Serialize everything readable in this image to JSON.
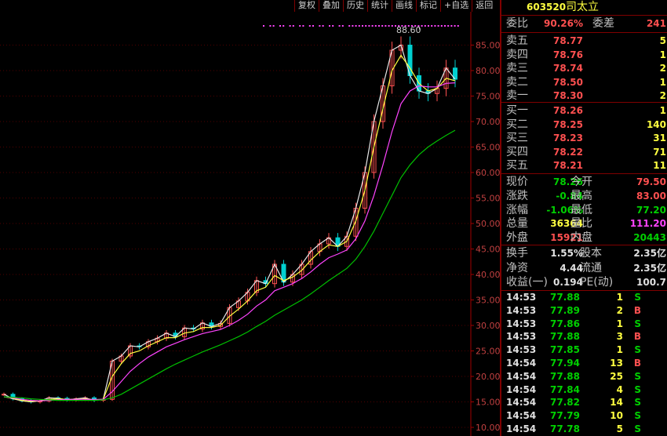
{
  "toolbar": [
    "复权",
    "叠加",
    "历史",
    "统计",
    "画线",
    "标记",
    "+自选",
    "返回"
  ],
  "stock": {
    "code": "603520",
    "name": "司太立"
  },
  "weibi": {
    "label": "委比",
    "value": "90.26%",
    "label2": "委差",
    "value2": "241"
  },
  "asks": [
    {
      "label": "卖五",
      "price": "78.77",
      "vol": "5"
    },
    {
      "label": "卖四",
      "price": "78.76",
      "vol": "1"
    },
    {
      "label": "卖三",
      "price": "78.74",
      "vol": "2"
    },
    {
      "label": "卖二",
      "price": "78.50",
      "vol": "1"
    },
    {
      "label": "卖一",
      "price": "78.30",
      "vol": "2"
    }
  ],
  "bids": [
    {
      "label": "买一",
      "price": "78.26",
      "vol": "1"
    },
    {
      "label": "买二",
      "price": "78.25",
      "vol": "140"
    },
    {
      "label": "买三",
      "price": "78.23",
      "vol": "31"
    },
    {
      "label": "买四",
      "price": "78.22",
      "vol": "71"
    },
    {
      "label": "买五",
      "price": "78.21",
      "vol": "11"
    }
  ],
  "quote": [
    {
      "l1": "现价",
      "v1": "78.26",
      "c1": "green",
      "l2": "今开",
      "v2": "79.50",
      "c2": "red"
    },
    {
      "l1": "涨跌",
      "v1": "-0.84",
      "c1": "green",
      "l2": "最高",
      "v2": "83.00",
      "c2": "red"
    },
    {
      "l1": "涨幅",
      "v1": "-1.06%",
      "c1": "green",
      "l2": "最低",
      "v2": "77.20",
      "c2": "green"
    },
    {
      "l1": "总量",
      "v1": "36364",
      "c1": "yellow",
      "l2": "量比",
      "v2": "111.20",
      "c2": "magenta"
    },
    {
      "l1": "外盘",
      "v1": "15921",
      "c1": "red",
      "l2": "内盘",
      "v2": "20443",
      "c2": "green"
    }
  ],
  "fundamentals": [
    {
      "l1": "换手",
      "v1": "1.55%",
      "l2": "股本",
      "v2": "2.35亿"
    },
    {
      "l1": "净资",
      "v1": "4.44",
      "l2": "流通",
      "v2": "2.35亿"
    },
    {
      "l1": "收益(一)",
      "v1": "0.194",
      "l2": "PE(动)",
      "v2": "100.7"
    }
  ],
  "ticks": [
    {
      "time": "14:53",
      "price": "77.88",
      "vol": "1",
      "side": "S"
    },
    {
      "time": "14:53",
      "price": "77.89",
      "vol": "2",
      "side": "B"
    },
    {
      "time": "14:53",
      "price": "77.86",
      "vol": "1",
      "side": "S"
    },
    {
      "time": "14:53",
      "price": "77.88",
      "vol": "3",
      "side": "B"
    },
    {
      "time": "14:53",
      "price": "77.85",
      "vol": "1",
      "side": "S"
    },
    {
      "time": "14:54",
      "price": "77.94",
      "vol": "13",
      "side": "B"
    },
    {
      "time": "14:54",
      "price": "77.88",
      "vol": "25",
      "side": "S"
    },
    {
      "time": "14:54",
      "price": "77.84",
      "vol": "4",
      "side": "S"
    },
    {
      "time": "14:54",
      "price": "77.82",
      "vol": "14",
      "side": "S"
    },
    {
      "time": "14:54",
      "price": "77.79",
      "vol": "10",
      "side": "S"
    },
    {
      "time": "14:54",
      "price": "77.78",
      "vol": "5",
      "side": "S"
    }
  ],
  "chart_data": {
    "type": "line",
    "title": "",
    "ylim": [
      10,
      90
    ],
    "yticks": [
      "85.00",
      "80.00",
      "75.00",
      "70.00",
      "65.00",
      "60.00",
      "55.00",
      "50.00",
      "45.00",
      "40.00",
      "35.00",
      "30.00",
      "25.00",
      "20.00",
      "15.00",
      "10.00"
    ],
    "max_label": "88.60",
    "series": [
      {
        "values": [
          16.5,
          15.6,
          15.2,
          15.0,
          15.2,
          15.8,
          15.7,
          15.4,
          15.6,
          15.8,
          15.3,
          15.5,
          23.0,
          24.0,
          26.0,
          25.8,
          26.8,
          27.5,
          28.5,
          27.8,
          29.5,
          29.3,
          30.5,
          29.8,
          30.4,
          33.5,
          34.8,
          36.5,
          38.8,
          38.2,
          42.0,
          38.5,
          40.0,
          42.0,
          44.5,
          46.0,
          47.2,
          45.5,
          47.5,
          53.0,
          60.0,
          70.0,
          77.0,
          84.0,
          85.0,
          79.0,
          76.0,
          75.5,
          76.5,
          80.5,
          78.3
        ],
        "color": "#e8e8e8"
      },
      {
        "values": [
          16.0,
          15.7,
          15.3,
          15.1,
          15.2,
          15.5,
          15.6,
          15.5,
          15.5,
          15.6,
          15.4,
          15.5,
          20.0,
          22.5,
          24.5,
          25.0,
          26.0,
          26.8,
          27.6,
          27.6,
          28.5,
          28.8,
          29.6,
          29.6,
          30.0,
          31.8,
          33.2,
          34.8,
          36.8,
          37.5,
          39.8,
          38.8,
          39.5,
          40.8,
          42.8,
          44.5,
          45.8,
          45.5,
          46.5,
          50.5,
          56.5,
          65.0,
          72.5,
          80.0,
          83.0,
          80.5,
          77.5,
          76.0,
          76.5,
          78.5,
          78.0
        ],
        "color": "#ffff40"
      },
      {
        "values": [
          16.0,
          15.8,
          15.5,
          15.3,
          15.2,
          15.3,
          15.4,
          15.5,
          15.5,
          15.5,
          15.5,
          15.5,
          17.0,
          19.0,
          21.0,
          22.5,
          23.8,
          24.8,
          25.8,
          26.5,
          27.2,
          27.8,
          28.4,
          28.8,
          29.2,
          30.0,
          31.0,
          32.2,
          33.8,
          35.0,
          36.8,
          37.5,
          38.2,
          39.2,
          40.5,
          42.0,
          43.3,
          44.0,
          44.8,
          47.0,
          50.5,
          55.5,
          61.5,
          68.0,
          73.5,
          76.0,
          77.0,
          76.8,
          76.8,
          77.5,
          77.6
        ],
        "color": "#ff44ff"
      },
      {
        "values": [
          16.0,
          15.9,
          15.8,
          15.6,
          15.5,
          15.4,
          15.3,
          15.3,
          15.3,
          15.3,
          15.3,
          15.4,
          15.8,
          16.5,
          17.5,
          18.5,
          19.5,
          20.5,
          21.5,
          22.4,
          23.2,
          24.0,
          24.8,
          25.5,
          26.2,
          27.0,
          27.8,
          28.7,
          29.8,
          30.8,
          32.0,
          33.0,
          34.0,
          35.0,
          36.2,
          37.5,
          38.8,
          40.0,
          41.2,
          43.0,
          45.5,
          48.5,
          52.0,
          55.5,
          59.0,
          61.5,
          63.5,
          65.0,
          66.2,
          67.3,
          68.3
        ],
        "color": "#00c000"
      }
    ]
  },
  "colors": {
    "up": "#ff5050",
    "down": "#00d000",
    "border": "#800000",
    "bg": "#000000"
  }
}
